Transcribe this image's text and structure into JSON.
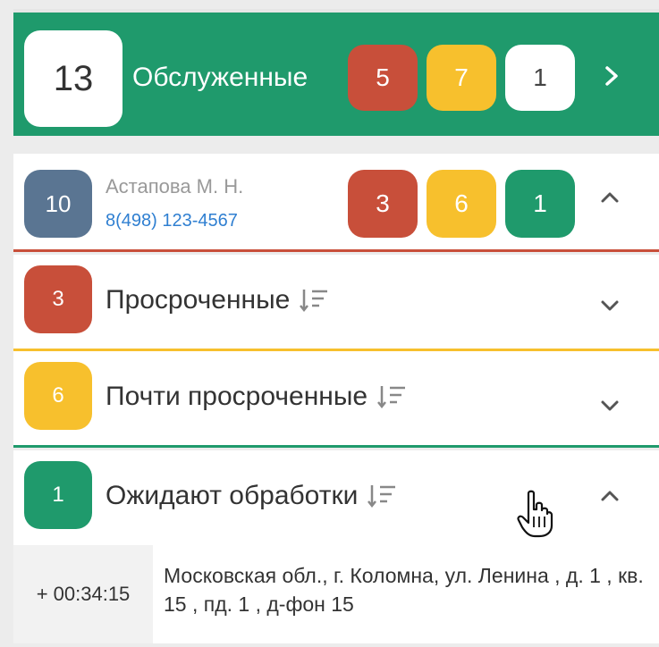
{
  "header": {
    "total": "13",
    "title": "Обслуженные",
    "badges": {
      "red": "5",
      "yellow": "7",
      "white": "1"
    }
  },
  "operator": {
    "total": "10",
    "name": "Астапова М. Н.",
    "phone": "8(498) 123-4567",
    "badges": {
      "red": "3",
      "yellow": "6",
      "green": "1"
    }
  },
  "sections": [
    {
      "count": "3",
      "label": "Просроченные",
      "color": "#c84f3a",
      "expanded": false
    },
    {
      "count": "6",
      "label": "Почти просроченные",
      "color": "#f7c02d",
      "expanded": false
    },
    {
      "count": "1",
      "label": "Ожидают обработки",
      "color": "#1f9a6c",
      "expanded": true
    }
  ],
  "request": {
    "timer": "+ 00:34:15",
    "address": "Московская обл., г. Коломна, ул. Ленина , д. 1 , кв. 15 , пд. 1 , д-фон 15"
  },
  "colors": {
    "accent": "#1f9a6c",
    "danger": "#c84f3a",
    "warning": "#f7c02d",
    "link": "#2f7fd1"
  }
}
